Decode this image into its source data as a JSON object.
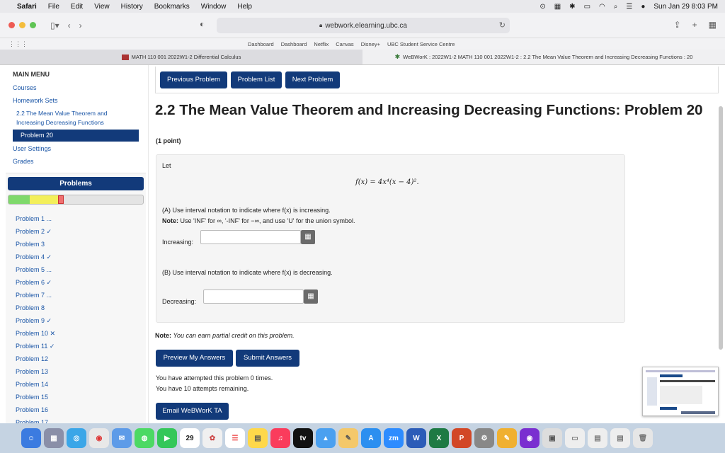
{
  "menubar": {
    "app": "Safari",
    "menus": [
      "File",
      "Edit",
      "View",
      "History",
      "Bookmarks",
      "Window",
      "Help"
    ],
    "clock": "Sun Jan 29  8:03 PM"
  },
  "browser": {
    "url": "webwork.elearning.ubc.ca",
    "favorites": [
      "Dashboard",
      "Dashboard",
      "Netflix",
      "Canvas",
      "Disney+",
      "UBC Student Service Centre"
    ],
    "tabs": [
      {
        "label": "MATH 110 001 2022W1-2 Differential Calculus"
      },
      {
        "label": "WeBWorK : 2022W1-2 MATH 110 001 2022W1-2 : 2.2 The Mean Value Theorem and Increasing Decreasing Functions : 20"
      }
    ]
  },
  "sidebar": {
    "main_menu": "MAIN MENU",
    "courses": "Courses",
    "homework_sets": "Homework Sets",
    "current_set": "2.2 The Mean Value Theorem and Increasing Decreasing Functions",
    "current_problem": "Problem 20",
    "user_settings": "User Settings",
    "grades": "Grades",
    "problems_header": "Problems",
    "problems": [
      "Problem 1 ...",
      "Problem 2 ✓",
      "Problem 3",
      "Problem 4 ✓",
      "Problem 5 ...",
      "Problem 6 ✓",
      "Problem 7 ...",
      "Problem 8",
      "Problem 9 ✓",
      "Problem 10 ✕",
      "Problem 11 ✓",
      "Problem 12",
      "Problem 13",
      "Problem 14",
      "Problem 15",
      "Problem 16",
      "Problem 17"
    ]
  },
  "nav": {
    "previous": "Previous Problem",
    "list": "Problem List",
    "next": "Next Problem"
  },
  "problem": {
    "title": "2.2 The Mean Value Theorem and Increasing Decreasing Functions: Problem 20",
    "points": "(1 point)",
    "let": "Let",
    "formula": "f(x) = 4x⁴(x − 4)².",
    "part_a": "(A) Use interval notation to indicate where f(x) is increasing.",
    "note_label": "Note:",
    "note_text": "Use 'INF' for ∞, '-INF' for −∞, and use 'U' for the union symbol.",
    "increasing_label": "Increasing:",
    "increasing_value": "",
    "part_b": "(B) Use interval notation to indicate where f(x) is decreasing.",
    "decreasing_label": "Decreasing:",
    "decreasing_value": ""
  },
  "footer": {
    "partial_label": "Note:",
    "partial_text": "You can earn partial credit on this problem.",
    "preview": "Preview My Answers",
    "submit": "Submit Answers",
    "attempted": "You have attempted this problem 0 times.",
    "remaining": "You have 10 attempts remaining.",
    "email": "Email WeBWorK TA"
  }
}
